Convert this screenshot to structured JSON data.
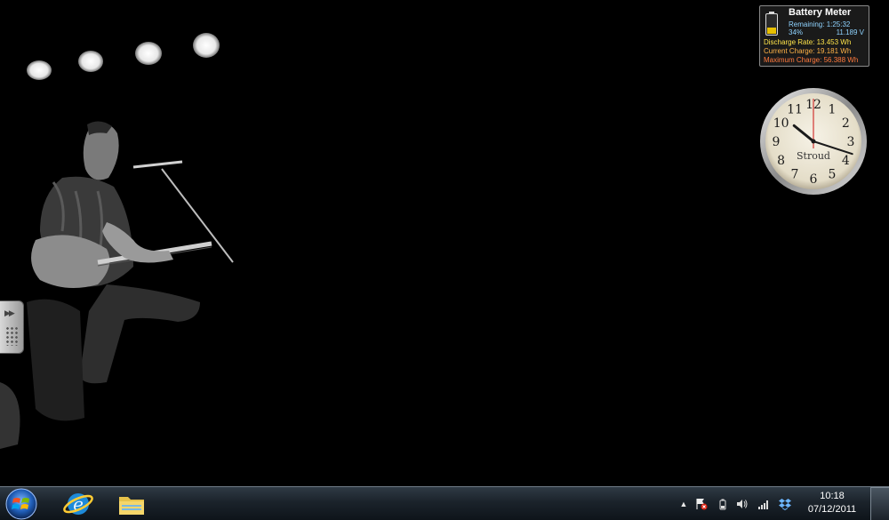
{
  "battery": {
    "title": "Battery Meter",
    "remaining": "Remaining: 1:25:32",
    "percent": "34%",
    "level": 0.34,
    "voltage": "11.189 V",
    "discharge_rate": "Discharge Rate: 13.453 Wh",
    "current_charge": "Current Charge: 19.181 Wh",
    "maximum_charge": "Maximum Charge: 56.388 Wh"
  },
  "clock_gadget": {
    "label": "Stroud",
    "numerals": [
      "12",
      "1",
      "2",
      "3",
      "4",
      "5",
      "6",
      "7",
      "8",
      "9",
      "10",
      "11"
    ],
    "time": "10:18"
  },
  "taskbar": {
    "pinned": [
      {
        "name": "internet-explorer",
        "icon": "ie-icon"
      },
      {
        "name": "windows-explorer",
        "icon": "folder-icon"
      }
    ],
    "tray": {
      "show_hidden": "▲",
      "icons": [
        "action-center-icon",
        "power-icon",
        "volume-icon",
        "network-signal-icon",
        "dropbox-icon"
      ]
    },
    "clock_time": "10:18",
    "clock_date": "07/12/2011"
  },
  "colors": {
    "remaining": "#8fd3ff",
    "discharge": "#ffe44a",
    "current": "#ffb347",
    "maximum": "#ff7a3d",
    "clock_second_hand": "#cc1111"
  }
}
